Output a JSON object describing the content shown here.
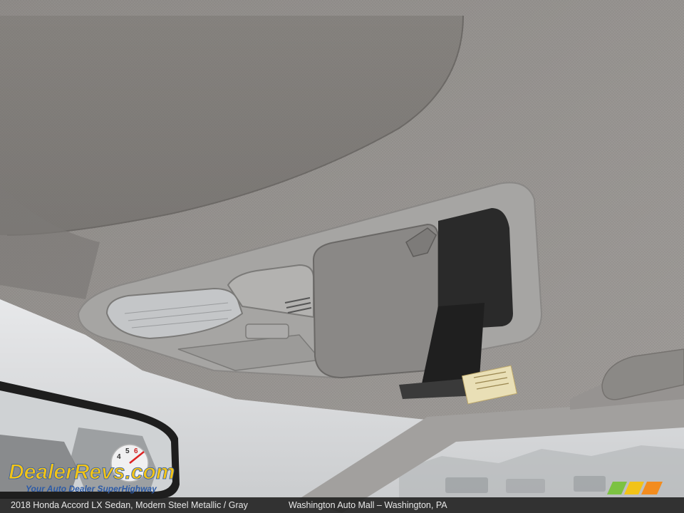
{
  "caption": {
    "car": "2018 Honda Accord LX Sedan,  Modern Steel Metallic / Gray",
    "dealer": "Washington Auto Mall – Washington, PA"
  },
  "watermark": {
    "brand": "DealerRevs.com",
    "tagline": "Your Auto Dealer SuperHighway"
  },
  "dealer_logo": {
    "icon": "wam-logo",
    "colors": [
      "#7cc242",
      "#f2c318",
      "#f28c1e"
    ]
  },
  "colors": {
    "headliner": "#8f8c89",
    "console": "#a4a4a4",
    "brand_yellow": "#f2c318",
    "brand_blue": "#2c5aa6"
  }
}
